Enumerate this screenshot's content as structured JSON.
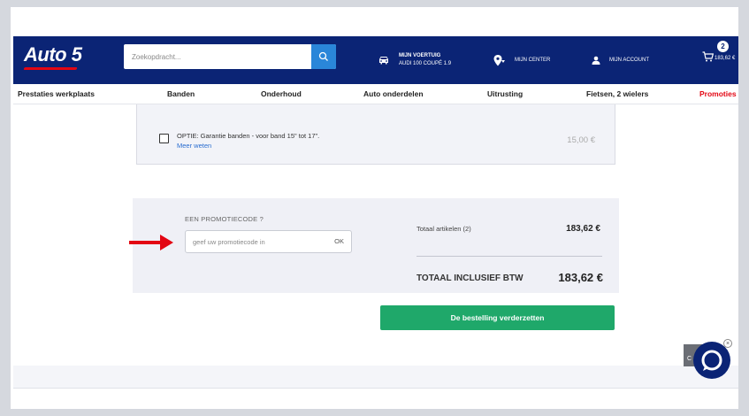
{
  "header": {
    "logo_text": "Auto 5",
    "search": {
      "placeholder": "Zoekopdracht..."
    },
    "vehicle": {
      "title": "MIJN VOERTUIG",
      "value": "AUDI 100 COUPÉ 1.9"
    },
    "center_label": "MIJN CENTER",
    "account_label": "MIJN ACCOUNT",
    "cart": {
      "count": "2",
      "total": "183,62 €"
    }
  },
  "nav": {
    "items": [
      "Prestaties werkplaats",
      "Banden",
      "Onderhoud",
      "Auto onderdelen",
      "Uitrusting",
      "Fietsen, 2 wielers",
      "Promoties"
    ]
  },
  "option": {
    "text": "OPTIE: Garantie banden - voor band 15\" tot 17\".",
    "link": "Meer weten",
    "price": "15,00 €"
  },
  "promo": {
    "label": "EEN PROMOTIECODE ?",
    "placeholder": "geef uw promotiecode in",
    "ok_label": "OK"
  },
  "summary": {
    "items_label": "Totaal artikelen (2)",
    "items_value": "183,62 €",
    "total_label": "TOTAAL INCLUSIEF BTW",
    "total_value": "183,62 €"
  },
  "cta_label": "De bestelling verderzetten",
  "chat": {
    "tab_text": "C",
    "close_icon": "×"
  },
  "colors": {
    "header_bg": "#0b2475",
    "accent_red": "#e30613",
    "cta_green": "#1fa86a",
    "search_button": "#2a86d9"
  }
}
